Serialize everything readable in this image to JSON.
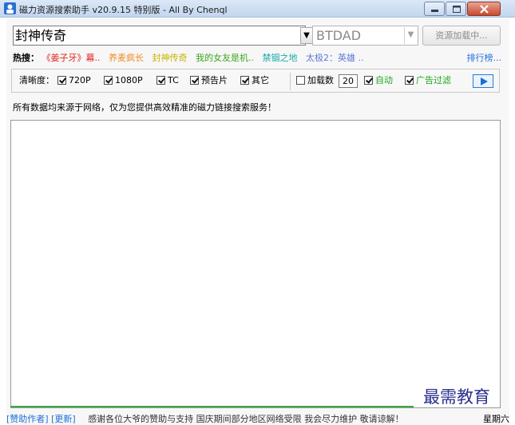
{
  "window": {
    "title": "磁力资源搜索助手 v20.9.15 特别版 - All By Chenql",
    "minimize_icon": "minimize-icon",
    "maximize_icon": "maximize-icon",
    "close_icon": "close-icon"
  },
  "search": {
    "query": "封神传奇",
    "source": "BTDAD",
    "load_button": "资源加载中..."
  },
  "hot": {
    "label": "热搜：",
    "items": [
      {
        "text": "《姜子牙》幕..",
        "color": "#e3231c"
      },
      {
        "text": "养麦疯长",
        "color": "#f28b1e"
      },
      {
        "text": "封神传奇",
        "color": "#c7b400"
      },
      {
        "text": "我的女友是机..",
        "color": "#3da51e"
      },
      {
        "text": "禁锢之地",
        "color": "#1ba8a8"
      },
      {
        "text": "太极2：英雄 ..",
        "color": "#5a78d8"
      }
    ],
    "rank_link": "排行榜..."
  },
  "options": {
    "quality_label": "清晰度：",
    "quality": [
      {
        "label": "720P",
        "checked": true
      },
      {
        "label": "1080P",
        "checked": true
      },
      {
        "label": "TC",
        "checked": true
      },
      {
        "label": "预告片",
        "checked": true
      },
      {
        "label": "其它",
        "checked": true
      }
    ],
    "load_count_label": "加载数",
    "load_count_checked": false,
    "load_count_value": "20",
    "auto_label": "自动",
    "auto_checked": true,
    "ad_filter_label": "广告过滤",
    "ad_filter_checked": true,
    "accent_color": "#1ea51e"
  },
  "notice": "所有数据均来源于网络，仅为您提供高效精准的磁力链接搜索服务！",
  "watermark": "最需教育",
  "status": {
    "sponsor_link": "[赞助作者]",
    "update_link": "[更新]",
    "message": "感谢各位大爷的赞助与支持 国庆期间部分地区网络受限 我会尽力维护 敬请谅解！",
    "day": "星期六"
  }
}
